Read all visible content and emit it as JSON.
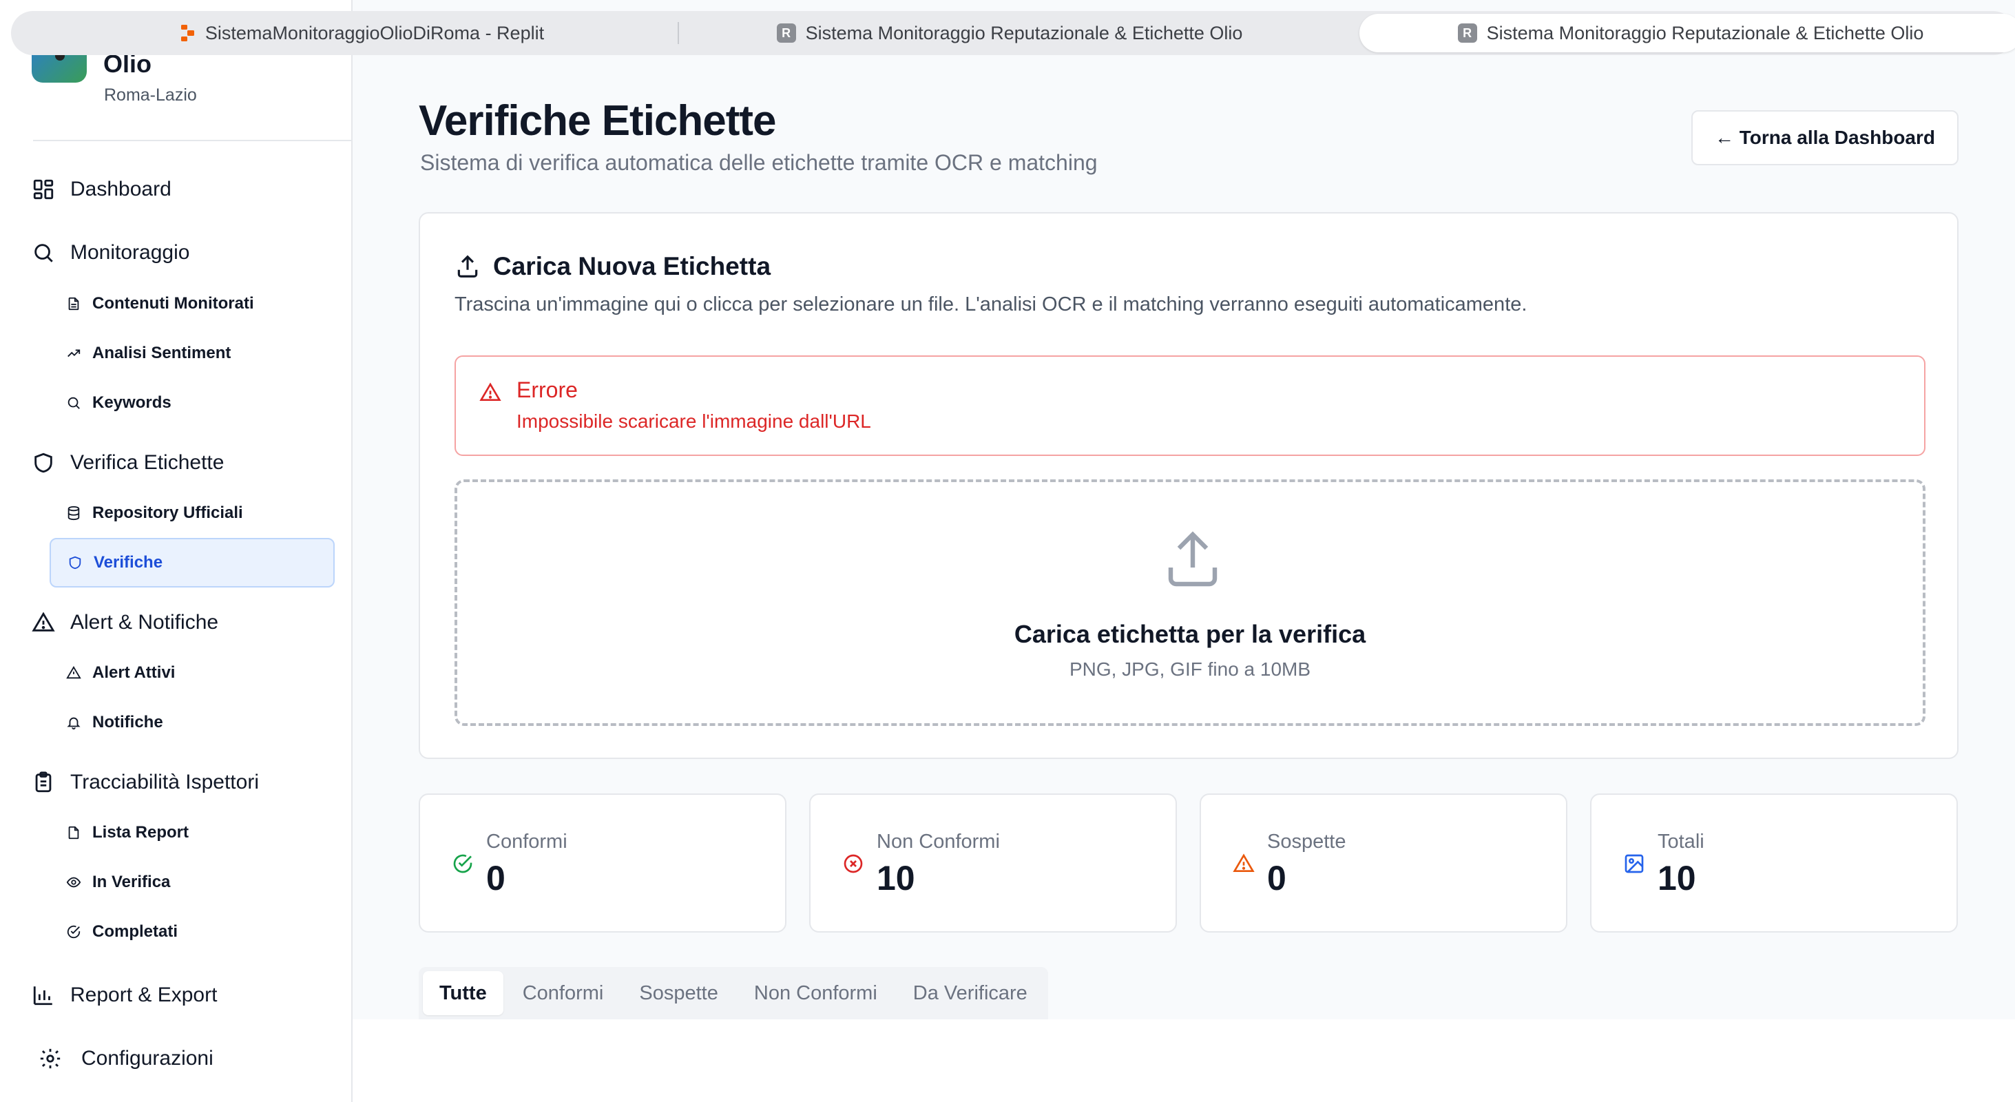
{
  "browser": {
    "tabs": [
      {
        "title": "SistemaMonitoraggioOlioDiRoma - Replit",
        "favicon": "replit-icon"
      },
      {
        "title": "Sistema Monitoraggio Reputazionale & Etichette Olio",
        "favicon": "R"
      },
      {
        "title": "Sistema Monitoraggio Reputazionale & Etichette Olio",
        "favicon": "R",
        "active": true
      }
    ]
  },
  "sidebar": {
    "brand_title": "Olio",
    "brand_subtitle": "Roma-Lazio",
    "dashboard": "Dashboard",
    "monitoraggio": {
      "label": "Monitoraggio",
      "items": [
        "Contenuti Monitorati",
        "Analisi Sentiment",
        "Keywords"
      ]
    },
    "verifica": {
      "label": "Verifica Etichette",
      "items": [
        "Repository Ufficiali",
        "Verifiche"
      ],
      "active": "Verifiche"
    },
    "alert": {
      "label": "Alert & Notifiche",
      "items": [
        "Alert Attivi",
        "Notifiche"
      ]
    },
    "tracciabilita": {
      "label": "Tracciabilità Ispettori",
      "items": [
        "Lista Report",
        "In Verifica",
        "Completati"
      ]
    },
    "report": "Report & Export",
    "config": "Configurazioni"
  },
  "main": {
    "title": "Verifiche Etichette",
    "subtitle": "Sistema di verifica automatica delle etichette tramite OCR e matching",
    "back_button": "← Torna alla Dashboard",
    "upload": {
      "title": "Carica Nuova Etichetta",
      "description": "Trascina un'immagine qui o clicca per selezionare un file. L'analisi OCR e il matching verranno eseguiti automaticamente.",
      "error_title": "Errore",
      "error_message": "Impossibile scaricare l'immagine dall'URL",
      "dropzone_title": "Carica etichetta per la verifica",
      "dropzone_sub": "PNG, JPG, GIF fino a 10MB"
    },
    "stats": [
      {
        "label": "Conformi",
        "value": "0",
        "icon": "check-circle-icon",
        "color": "#16a34a"
      },
      {
        "label": "Non Conformi",
        "value": "10",
        "icon": "x-circle-icon",
        "color": "#dc2626"
      },
      {
        "label": "Sospette",
        "value": "0",
        "icon": "warning-icon",
        "color": "#ea580c"
      },
      {
        "label": "Totali",
        "value": "10",
        "icon": "image-icon",
        "color": "#2563eb"
      }
    ],
    "filter_tabs": [
      "Tutte",
      "Conformi",
      "Sospette",
      "Non Conformi",
      "Da Verificare"
    ],
    "active_filter": "Tutte"
  },
  "colors": {
    "accent": "#2563eb",
    "error": "#dc2626",
    "active_bg": "#eaf2fe"
  }
}
